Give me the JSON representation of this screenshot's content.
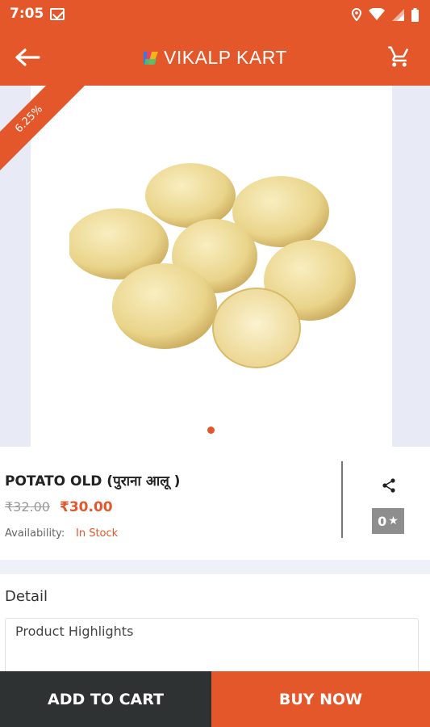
{
  "status_bar": {
    "time": "7:05"
  },
  "app_bar": {
    "brand_name": "VIKALP KART"
  },
  "gallery": {
    "discount_badge": "6.25%"
  },
  "product": {
    "title": "POTATO OLD (पुराना आलू )",
    "old_price": "₹32.00",
    "new_price": "₹30.00",
    "availability_label": "Availability:",
    "availability_value": "In Stock",
    "rating": "0",
    "rating_star": "★"
  },
  "detail": {
    "title": "Detail",
    "highlights_label": "Product Highlights"
  },
  "actions": {
    "add_to_cart": "ADD TO CART",
    "buy_now": "BUY NOW"
  },
  "colors": {
    "accent": "#e4572a",
    "dark_button": "#2f3233",
    "rating_badge": "#8e8e8e"
  }
}
